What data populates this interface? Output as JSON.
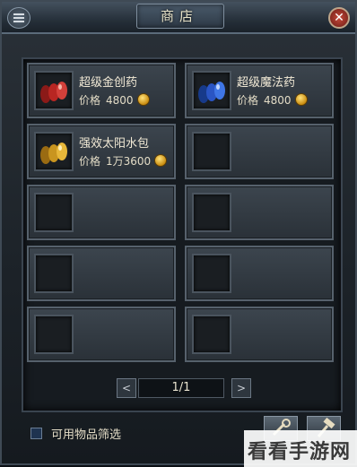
{
  "window": {
    "title": "商店"
  },
  "shop": {
    "items": [
      {
        "name": "超级金创药",
        "price_label": "价格",
        "price": "4800",
        "icon": "red-potion-icon",
        "color": "#c8302c"
      },
      {
        "name": "超级魔法药",
        "price_label": "价格",
        "price": "4800",
        "icon": "blue-potion-icon",
        "color": "#2e5fd0"
      },
      {
        "name": "强效太阳水包",
        "price_label": "价格",
        "price": "1万3600",
        "icon": "gold-potion-icon",
        "color": "#d9a62b"
      }
    ],
    "empty_slots": 7
  },
  "pager": {
    "prev": "<",
    "page": "1/1",
    "next": ">"
  },
  "footer": {
    "filter_label": "可用物品筛选",
    "filter_checked": false
  },
  "watermark": {
    "text": "看看手游网"
  }
}
